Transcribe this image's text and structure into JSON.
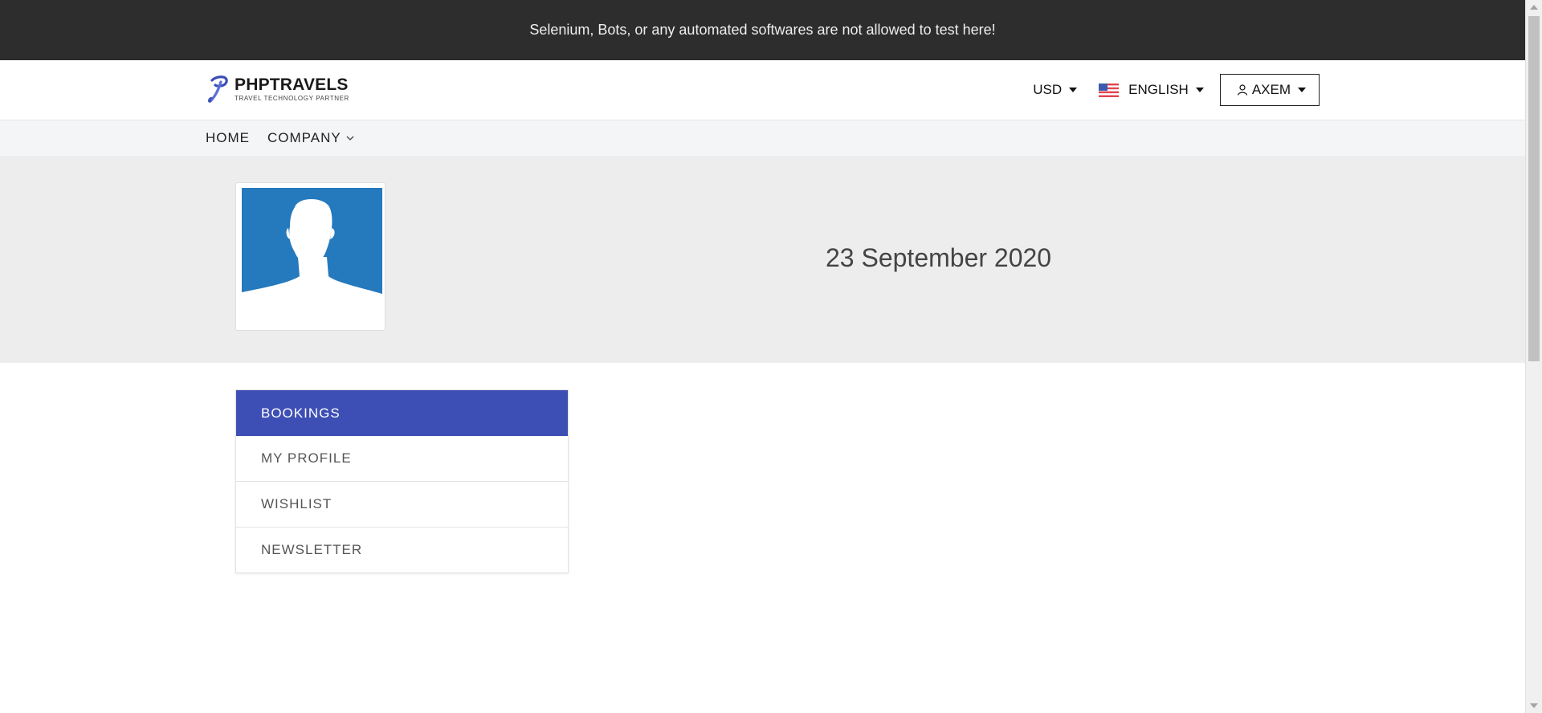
{
  "notice": "Selenium, Bots, or any automated softwares are not allowed to test here!",
  "brand": {
    "name": "PHPTRAVELS",
    "tagline": "TRAVEL TECHNOLOGY PARTNER",
    "color": "#3d4eb5"
  },
  "header": {
    "currency": "USD",
    "language": "ENGLISH",
    "user": "AXEM"
  },
  "nav": {
    "items": [
      {
        "label": "HOME"
      },
      {
        "label": "COMPANY"
      }
    ]
  },
  "profile": {
    "date": "23 September 2020",
    "avatar_color": "#2579bd"
  },
  "menu": {
    "active_color": "#3d4eb5",
    "items": [
      {
        "label": "BOOKINGS",
        "active": true
      },
      {
        "label": "MY PROFILE",
        "active": false
      },
      {
        "label": "WISHLIST",
        "active": false
      },
      {
        "label": "NEWSLETTER",
        "active": false
      }
    ]
  },
  "icons": {
    "logo": "phptravels-logo-icon",
    "flag": "us-flag-icon",
    "user": "user-icon",
    "caret": "caret-down-icon",
    "chevron": "chevron-down-icon"
  }
}
